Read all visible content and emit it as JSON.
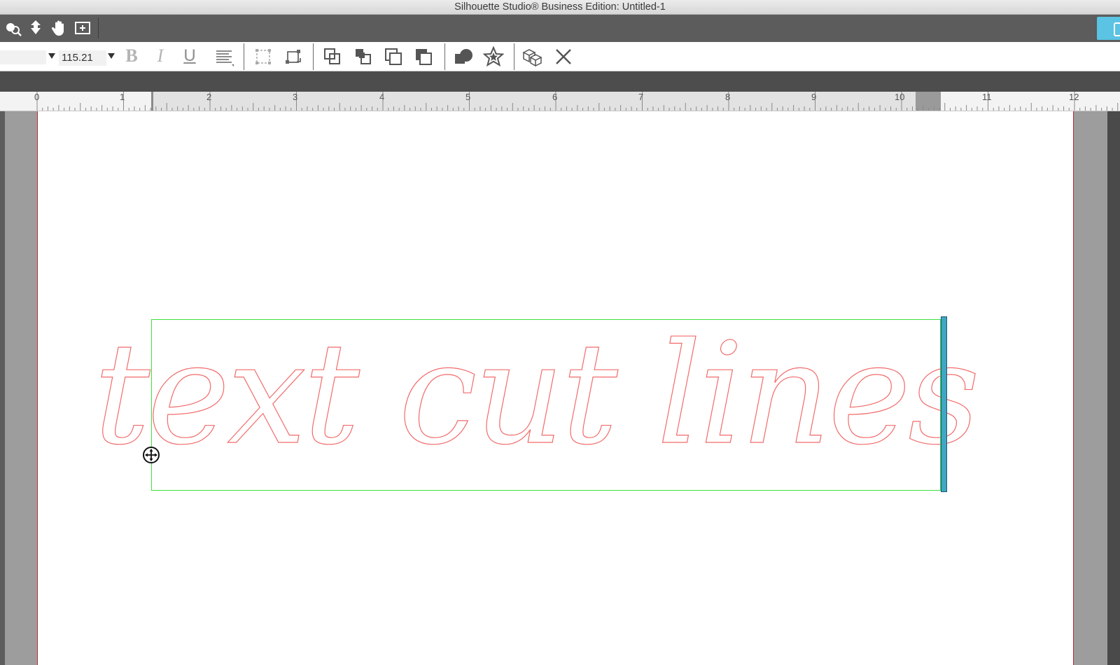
{
  "window": {
    "title": "Silhouette Studio® Business Edition: Untitled-1"
  },
  "top_toolbar": {
    "icons": [
      "zoom-select-icon",
      "pan-down-icon",
      "hand-pan-icon",
      "zoom-fit-icon"
    ]
  },
  "text_toolbar": {
    "font_name_value": "",
    "font_size_value": "115.21",
    "bold_label": "B",
    "italic_label": "I",
    "underline_label": "U",
    "icons": [
      "align-text-icon",
      "transform-box-icon",
      "rotate-box-icon",
      "bring-to-front-icon",
      "bring-forward-icon",
      "send-backward-icon",
      "send-to-back-icon",
      "merge-shapes-icon",
      "star-shape-icon",
      "3d-box-icon",
      "delete-icon"
    ]
  },
  "ruler": {
    "labels": [
      "0",
      "1",
      "2",
      "3",
      "4",
      "5",
      "6",
      "7",
      "8",
      "9",
      "10",
      "11",
      "12"
    ]
  },
  "canvas": {
    "text_object": "text cut lines",
    "cut_line_color": "#f26a6a",
    "selection_color": "#3be03b",
    "handle_color": "#3fa6c6"
  }
}
